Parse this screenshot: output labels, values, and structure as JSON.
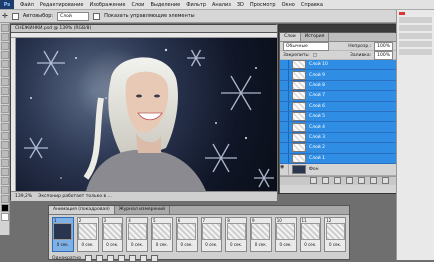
{
  "app": {
    "logo": "Ps"
  },
  "menu": [
    "Файл",
    "Редактирование",
    "Изображение",
    "Слои",
    "Выделение",
    "Фильтр",
    "Анализ",
    "3D",
    "Просмотр",
    "Окно",
    "Справка"
  ],
  "options": {
    "autoselect_label": "Автовыбор:",
    "autoselect_value": "Слой",
    "show_controls": "Показать управляющие элементы"
  },
  "document": {
    "title": "СНЕЖИНКИ.psd @ 139% (RGB/8)",
    "zoom": "139,2%",
    "status": "Экспонир работает только в ..."
  },
  "layers_panel": {
    "tabs": [
      "Слои",
      "История"
    ],
    "blend_mode": "Обычные",
    "opacity_label": "Непрозр.:",
    "opacity_value": "100%",
    "lock_label": "Закрепить:",
    "fill_label": "Заливка:",
    "fill_value": "100%",
    "layers": [
      "Слой 10",
      "Слой 9",
      "Слой 8",
      "Слой 7",
      "Слой 6",
      "Слой 5",
      "Слой 4",
      "Слой 3",
      "Слой 2",
      "Слой 1"
    ],
    "background_layer": "Фон"
  },
  "animation_panel": {
    "tabs": [
      "Анимация (покадровая)",
      "Журнал измерений"
    ],
    "frames": [
      {
        "n": "1",
        "t": "0 сек."
      },
      {
        "n": "2",
        "t": "0 сек."
      },
      {
        "n": "3",
        "t": "0 сек."
      },
      {
        "n": "4",
        "t": "0 сек."
      },
      {
        "n": "5",
        "t": "0 сек."
      },
      {
        "n": "6",
        "t": "0 сек."
      },
      {
        "n": "7",
        "t": "0 сек."
      },
      {
        "n": "8",
        "t": "0 сек."
      },
      {
        "n": "9",
        "t": "0 сек."
      },
      {
        "n": "10",
        "t": "0 сек."
      },
      {
        "n": "11",
        "t": "0 сек."
      },
      {
        "n": "12",
        "t": "0 сек."
      }
    ],
    "loop_value": "Однократно"
  },
  "colors": {
    "selected_layer": "#2f8de4",
    "canvas_dark": "#101627"
  }
}
